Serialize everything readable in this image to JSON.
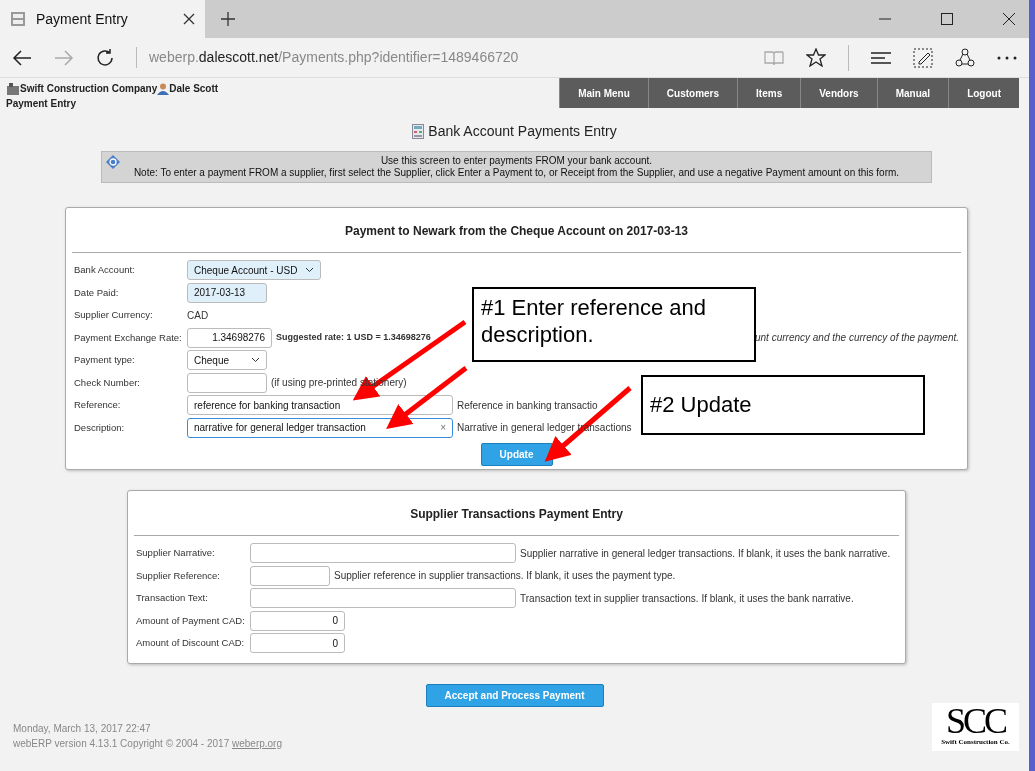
{
  "browser": {
    "tab_title": "Payment Entry",
    "url_prefix": "weberp.",
    "url_host": "dalescott.net",
    "url_path": "/Payments.php?identifier=1489466720"
  },
  "header": {
    "company": "Swift Construction Company",
    "user": "Dale Scott",
    "page": "Payment Entry"
  },
  "menu": [
    {
      "label": "Main Menu"
    },
    {
      "label": "Customers"
    },
    {
      "label": "Items"
    },
    {
      "label": "Vendors"
    },
    {
      "label": "Manual"
    },
    {
      "label": "Logout"
    }
  ],
  "title": "Bank Account Payments Entry",
  "info": [
    "Use this screen to enter payments FROM your bank account.",
    "Note: To enter a payment FROM a supplier, first select the Supplier, click Enter a Payment to, or Receipt from the Supplier, and use a negative Payment amount on this form."
  ],
  "payment": {
    "heading": "Payment to Newark from the Cheque Account on 2017-03-13",
    "rows": [
      {
        "label": "Bank Account:",
        "kind": "select",
        "value": "Cheque Account - USD",
        "highlighted": true,
        "focused": false
      },
      {
        "label": "Date Paid:",
        "kind": "input",
        "value": "2017-03-13",
        "highlighted": true,
        "focused": false
      },
      {
        "label": "Supplier Currency:",
        "kind": "static",
        "value": "CAD"
      },
      {
        "label": "Payment Exchange Rate:",
        "kind": "number",
        "value": "1.34698276",
        "highlighted": false,
        "focused": false,
        "note": "Suggested rate: 1 USD = 1.34698276",
        "note_tail": "unt currency and the currency of the payment."
      },
      {
        "label": "Payment type:",
        "kind": "select",
        "value": "Cheque",
        "highlighted": false,
        "focused": false
      },
      {
        "label": "Check Number:",
        "kind": "input",
        "value": "",
        "highlighted": false,
        "focused": false,
        "note": "(if using pre-printed stationery)"
      },
      {
        "label": "Reference:",
        "kind": "wide",
        "value": "reference for banking transaction",
        "highlighted": false,
        "focused": false,
        "note": "Reference in banking transactio"
      },
      {
        "label": "Description:",
        "kind": "wide",
        "value": "narrative for general ledger transaction",
        "highlighted": false,
        "focused": true,
        "clear_symbol": "×",
        "note": "Narrative in general ledger transactions"
      }
    ],
    "button": "Update"
  },
  "callouts": [
    "#1 Enter reference and description.",
    "#2 Update"
  ],
  "supplier": {
    "heading": "Supplier Transactions Payment Entry",
    "rows": [
      {
        "label": "Supplier Narrative:",
        "kind": "wide",
        "value": "",
        "note": "Supplier narrative in general ledger transactions. If blank, it uses the bank narrative."
      },
      {
        "label": "Supplier Reference:",
        "kind": "input",
        "value": "",
        "note": "Supplier reference in supplier transactions. If blank, it uses the payment type."
      },
      {
        "label": "Transaction Text:",
        "kind": "wide",
        "value": "",
        "note": "Transaction text in supplier transactions. If blank, it uses the bank narrative."
      },
      {
        "label": "Amount of Payment CAD:",
        "kind": "number",
        "value": "0"
      },
      {
        "label": "Amount of Discount CAD:",
        "kind": "number",
        "value": "0"
      }
    ]
  },
  "accept_button": "Accept and Process Payment",
  "footer": {
    "date": "Monday, March 13, 2017 22:47",
    "version": "webERP version 4.13.1 Copyright © 2004 - 2017",
    "link": "weberp.org"
  },
  "logo": {
    "letters": "SCC",
    "caption": "Swift Construction Co."
  }
}
